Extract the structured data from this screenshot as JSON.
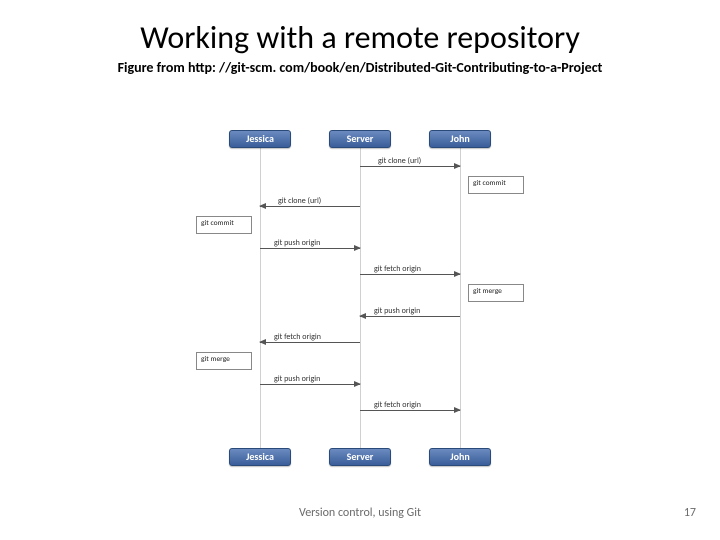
{
  "title": "Working with a remote repository",
  "subtitle": "Figure from http: //git-scm. com/book/en/Distributed-Git-Contributing-to-a-Project",
  "actors": {
    "jessica": "Jessica",
    "server": "Server",
    "john": "John"
  },
  "messages": {
    "clone_john": "git clone (url)",
    "commit_john": "git commit",
    "clone_jessica": "git clone (url)",
    "commit_jessica": "git commit",
    "push_jessica_1": "git push origin",
    "fetch_john_1": "git fetch origin",
    "merge_john": "git merge",
    "push_john": "git push origin",
    "fetch_jessica": "git fetch origin",
    "merge_jessica": "git merge",
    "push_jessica_2": "git push origin",
    "fetch_john_2": "git fetch origin"
  },
  "footer": "Version control, using Git",
  "page": "17"
}
